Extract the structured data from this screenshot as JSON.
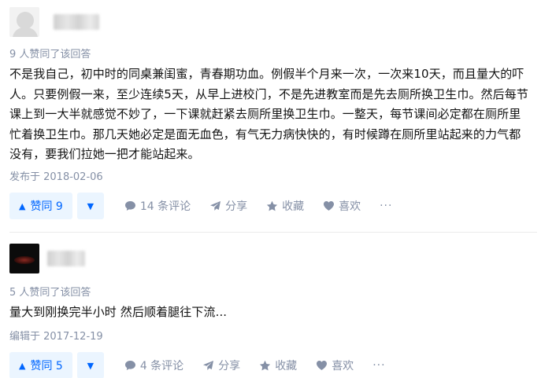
{
  "answers": [
    {
      "voters_text": "9 人赞同了该回答",
      "content_lines": [
        "不是我自己，初中时的同桌兼闺蜜，青春期功血。例假半个月来一次，一次来10天，而且量大的吓",
        "人。只要例假一来，至少连续5天，从早上进校门，不是先进教室而是先去厕所换卫生巾。然后每节",
        "课上到一大半就感觉不妙了，一下课就赶紧去厕所里换卫生巾。一整天，每节课间必定都在厕所里",
        "忙着换卫生巾。那几天她必定是面无血色，有气无力病快快的，有时候蹲在厕所里站起来的力气都",
        "没有，要我们拉她一把才能站起来。"
      ],
      "time_text": "发布于 2018-02-06",
      "vote_label": "赞同 9",
      "comment_label": "14 条评论",
      "share_label": "分享",
      "collect_label": "收藏",
      "like_label": "喜欢",
      "more_label": "···"
    },
    {
      "voters_text": "5 人赞同了该回答",
      "content_lines": [
        "量大到刚换完半小时 然后顺着腿往下流..."
      ],
      "time_text": "编辑于 2017-12-19",
      "vote_label": "赞同 5",
      "comment_label": "4 条评论",
      "share_label": "分享",
      "collect_label": "收藏",
      "like_label": "喜欢",
      "more_label": "···"
    }
  ],
  "colors": {
    "accent": "#0066ff",
    "accent_bg": "#ebf5ff",
    "meta": "#8590a6",
    "text": "#121212"
  },
  "icons": [
    "up-triangle-icon",
    "down-triangle-icon",
    "comment-icon",
    "share-icon",
    "star-icon",
    "heart-icon",
    "more-icon"
  ]
}
